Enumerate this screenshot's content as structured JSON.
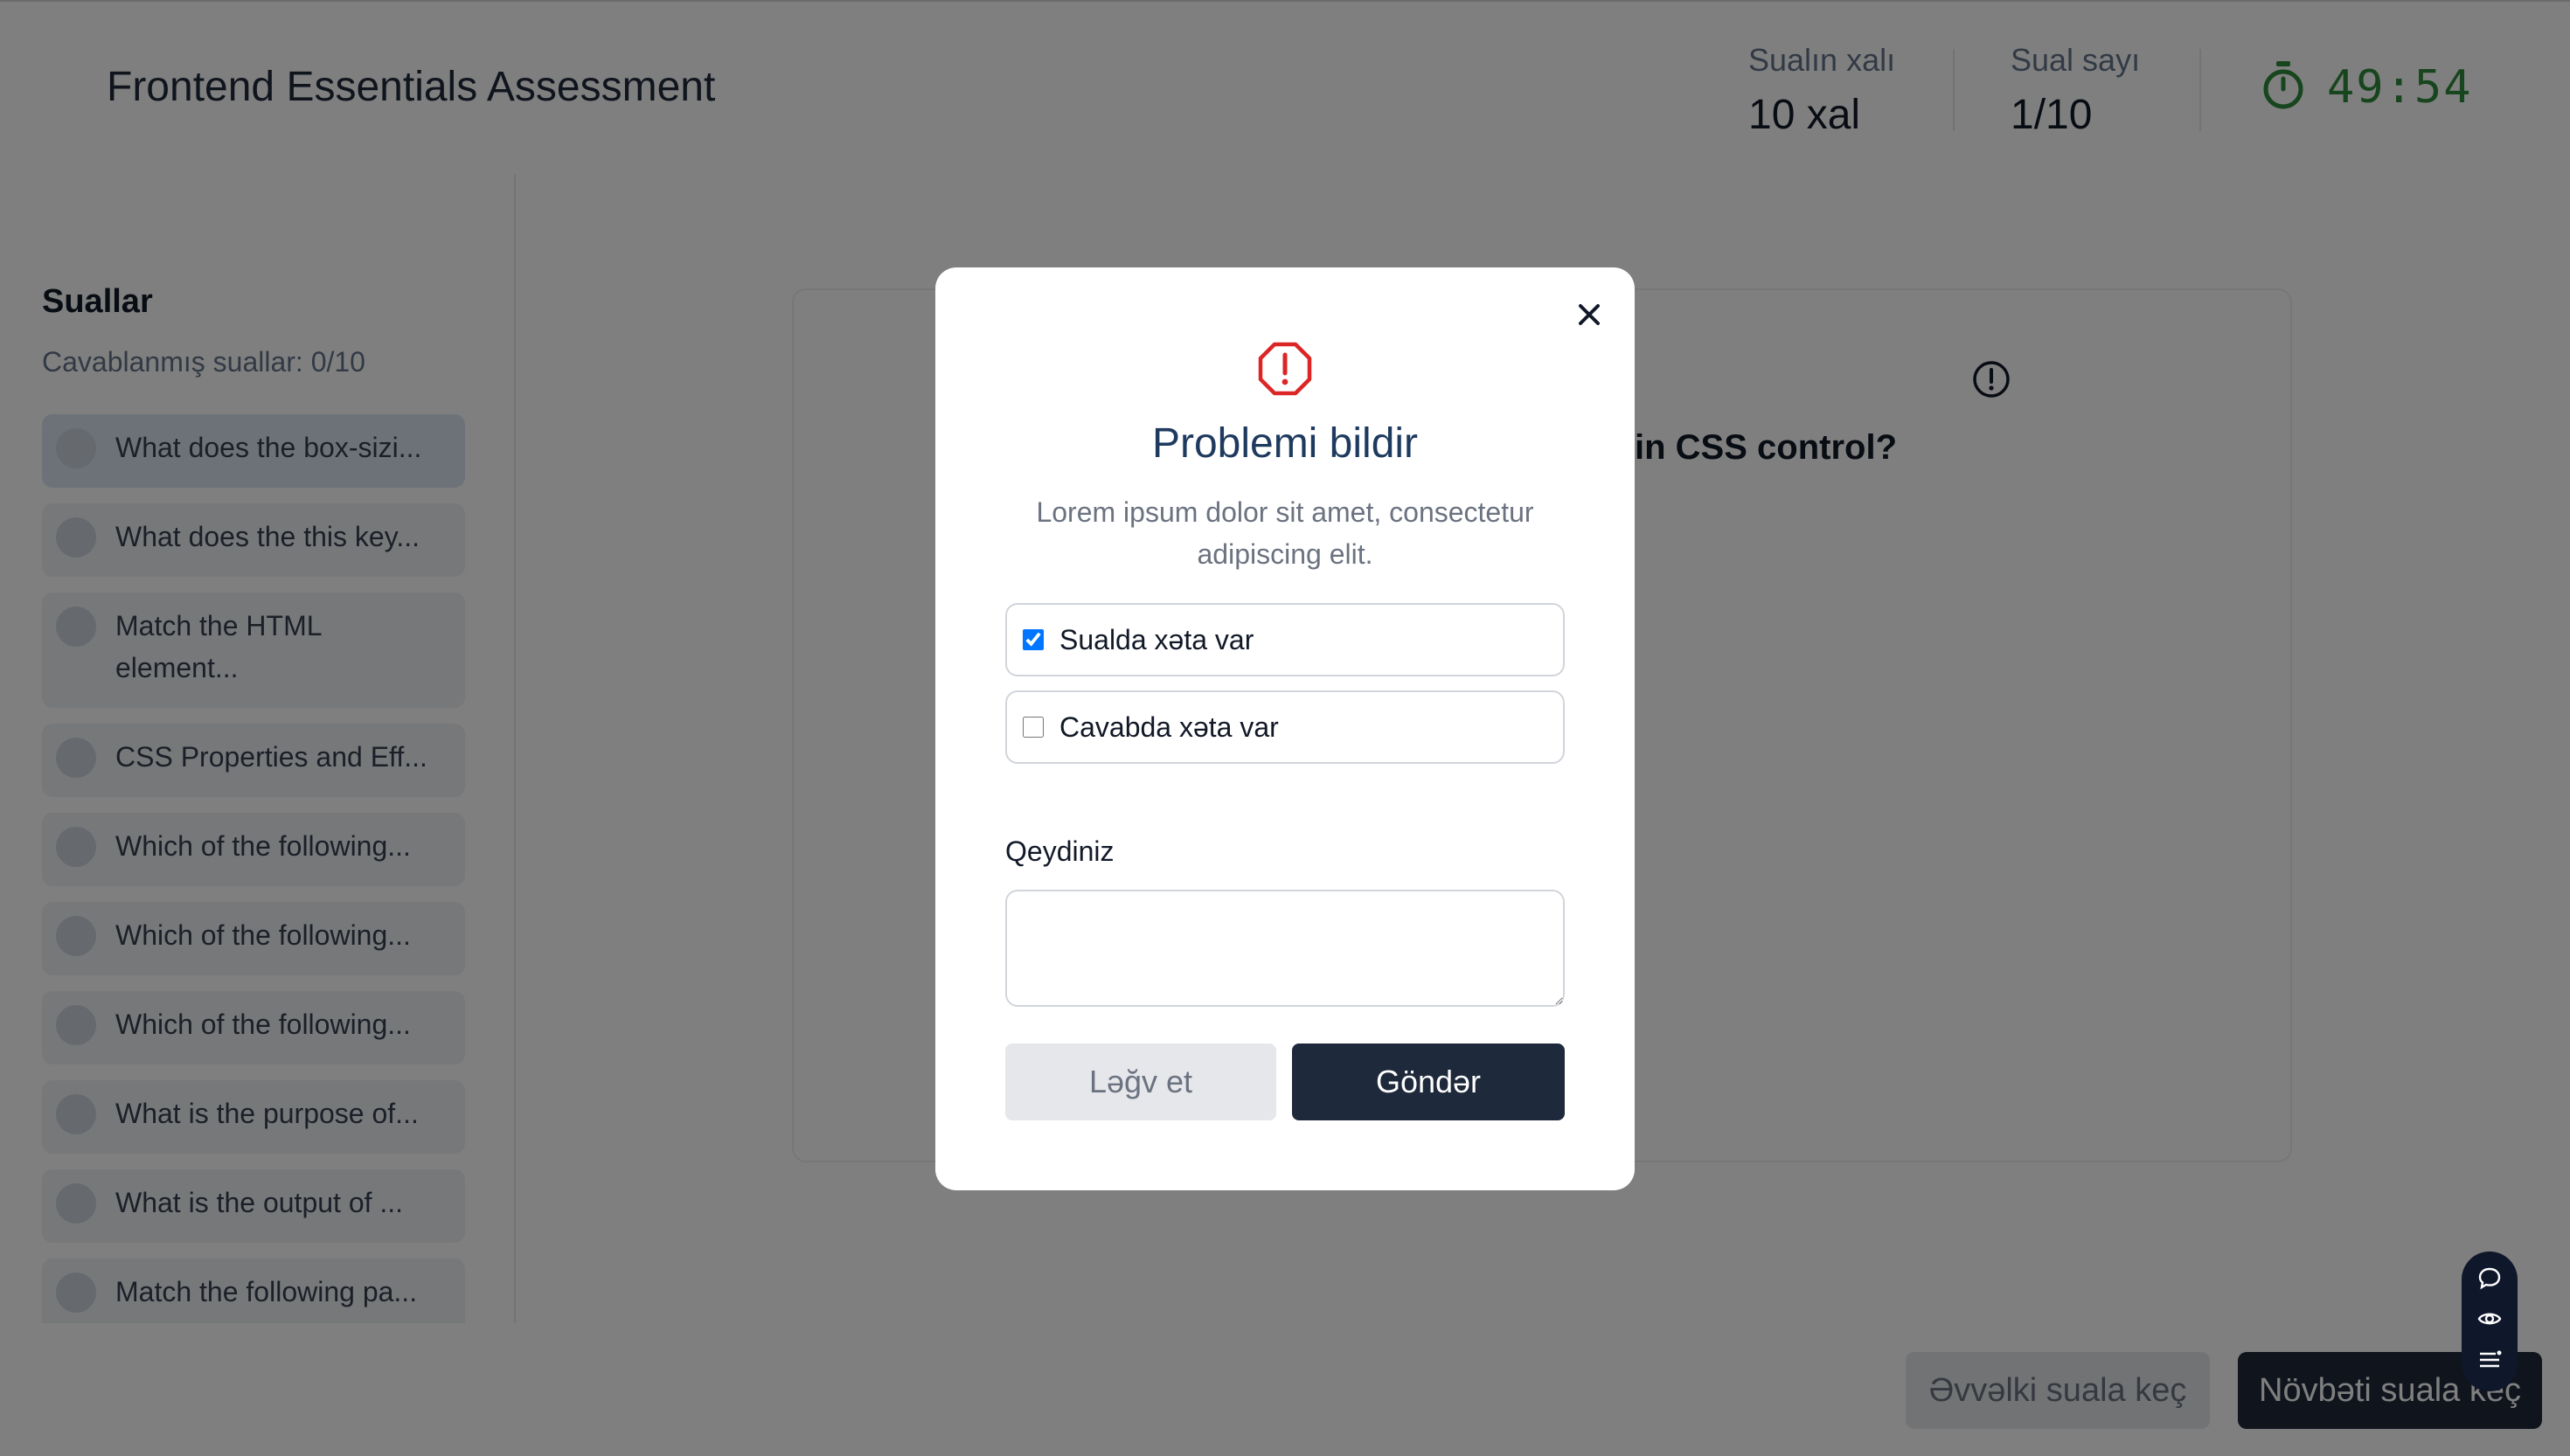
{
  "header": {
    "title": "Frontend Essentials Assessment",
    "score_label": "Sualın xalı",
    "score_value": "10 xal",
    "count_label": "Sual sayı",
    "count_value": "1/10",
    "timer": "49:54"
  },
  "sidebar": {
    "title": "Suallar",
    "answered": "Cavablanmış suallar: 0/10",
    "items": [
      {
        "label": "What does the box-sizi..."
      },
      {
        "label": "What does the this key..."
      },
      {
        "label": "Match the HTML element..."
      },
      {
        "label": "CSS Properties and Eff..."
      },
      {
        "label": "Which of the following..."
      },
      {
        "label": "Which of the following..."
      },
      {
        "label": "Which of the following..."
      },
      {
        "label": "What is the purpose of..."
      },
      {
        "label": "What is the output of ..."
      },
      {
        "label": "Match the following pa..."
      }
    ]
  },
  "question": {
    "text_visible": "in CSS control?"
  },
  "footer": {
    "prev_label": "Əvvəlki suala keç",
    "next_label": "Növbəti suala keç"
  },
  "modal": {
    "title": "Problemi bildir",
    "description": "Lorem ipsum dolor sit amet, consectetur adipiscing elit.",
    "option1": "Sualda xəta var",
    "option1_checked": true,
    "option2": "Cavabda xəta var",
    "option2_checked": false,
    "note_label": "Qeydiniz",
    "note_value": "",
    "cancel_label": "Ləğv et",
    "send_label": "Göndər"
  },
  "colors": {
    "accent_dark": "#1e293b",
    "timer_green": "#2f8a3a",
    "alert_red": "#dc2626",
    "checkbox_blue": "#2563eb"
  }
}
